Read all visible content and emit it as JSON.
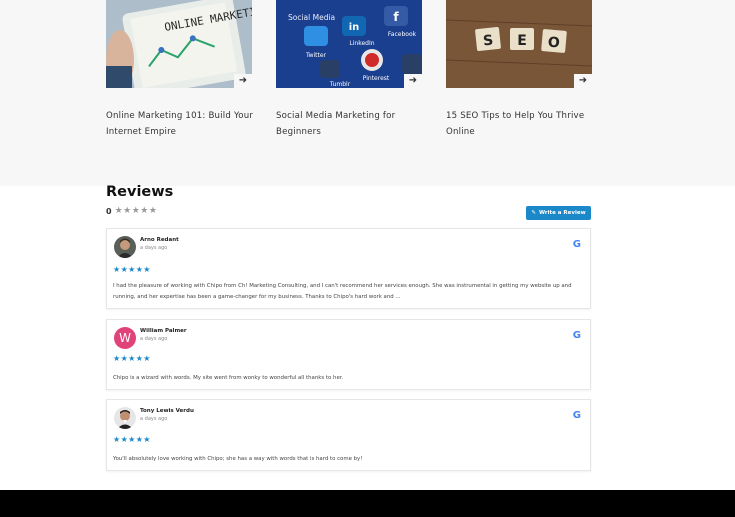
{
  "posts": [
    {
      "title": "Online Marketing 101: Build Your Internet Empire",
      "image_label": "ONLINE MARKETING",
      "arrow": "➜"
    },
    {
      "title": "Social Media Marketing for Beginners",
      "image_label": "Social Media",
      "arrow": "➜"
    },
    {
      "title": "15 SEO Tips to Help You Thrive Online",
      "image_label": "SEO",
      "arrow": "➜"
    }
  ],
  "reviews_section": {
    "heading": "Reviews",
    "average": "0",
    "empty_stars": "★★★★★",
    "write_button_label": "Write a Review",
    "write_button_icon": "✎"
  },
  "reviews": [
    {
      "name": "Arno Redant",
      "time": "a days ago",
      "stars": "★★★★★",
      "text": "I had the pleasure of working with Chipo from Ch! Marketing Consulting, and I can't recommend her services enough. She was instrumental in getting my website up and running, and her expertise has been a game-changer for my business. Thanks to Chipo's hard work and ..."
    },
    {
      "name": "William Palmer",
      "time": "a days ago",
      "avatar_letter": "W",
      "stars": "★★★★★",
      "text": "Chipo is a wizard with words. My site went from wonky to wonderful all thanks to her."
    },
    {
      "name": "Tony Lewis Verdu",
      "time": "a days ago",
      "stars": "★★★★★",
      "text": "You'll absolutely love working with Chipo; she has a way with words that is hard to come by!"
    }
  ],
  "google_icon": "G",
  "colors": {
    "accent": "#1a88c9",
    "band": "#f7f7f7",
    "footer": "#000000",
    "avatar_w": "#e0427a"
  }
}
